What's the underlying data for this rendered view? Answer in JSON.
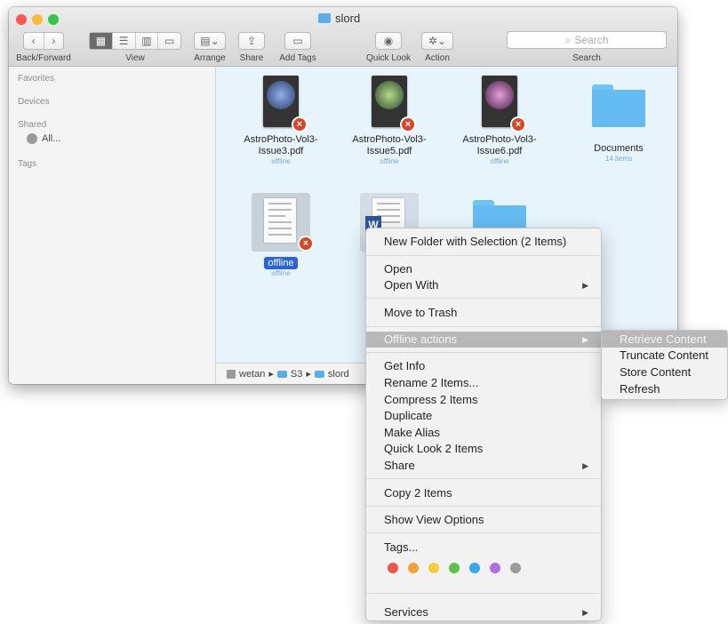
{
  "window": {
    "title": "slord",
    "traffic_lights": [
      "#fc5753",
      "#fdbc40",
      "#33c748"
    ]
  },
  "toolbar": {
    "back_forward_label": "Back/Forward",
    "back_icon": "‹",
    "forward_icon": "›",
    "view_label": "View",
    "arrange_label": "Arrange",
    "share_label": "Share",
    "add_tags_label": "Add Tags",
    "quick_look_label": "Quick Look",
    "action_label": "Action",
    "search_label": "Search",
    "search_placeholder": "Search"
  },
  "sidebar": {
    "favorites": "Favorites",
    "devices": "Devices",
    "shared": "Shared",
    "shared_item": "All...",
    "tags": "Tags"
  },
  "files": [
    {
      "name_line1": "AstroPhoto-Vol3-",
      "name_line2": "Issue3.pdf",
      "status": "offline",
      "color": "#5a7ab8"
    },
    {
      "name_line1": "AstroPhoto-Vol3-",
      "name_line2": "Issue5.pdf",
      "status": "offline",
      "color": "#6a9a5a"
    },
    {
      "name_line1": "AstroPhoto-Vol3-",
      "name_line2": "Issue6.pdf",
      "status": "offline",
      "color": "#a05aa0"
    },
    {
      "name_line1": "Documents",
      "status": "14 items"
    }
  ],
  "selected_file": {
    "label": "offline",
    "status": "offline"
  },
  "word_badge": "W",
  "pathbar": {
    "items": [
      "wetan",
      "S3",
      "slord"
    ],
    "separator": "▸"
  },
  "context_menu": {
    "new_folder": "New Folder with Selection (2 Items)",
    "open": "Open",
    "open_with": "Open With",
    "move_to_trash": "Move to Trash",
    "offline_actions": "Offline actions",
    "get_info": "Get Info",
    "rename": "Rename 2 Items...",
    "compress": "Compress 2 Items",
    "duplicate": "Duplicate",
    "make_alias": "Make Alias",
    "quick_look": "Quick Look 2 Items",
    "share": "Share",
    "copy": "Copy 2 Items",
    "show_view_options": "Show View Options",
    "tags": "Tags...",
    "services": "Services",
    "submenu_arrow": "▶",
    "tag_colors": [
      "#f0534d",
      "#f5a03a",
      "#f6cd3a",
      "#5ec24a",
      "#3aa6ee",
      "#b26ee0",
      "#9b9b9b"
    ]
  },
  "submenu": {
    "items": [
      "Retrieve Content",
      "Truncate Content",
      "Store Content",
      "Refresh"
    ]
  }
}
